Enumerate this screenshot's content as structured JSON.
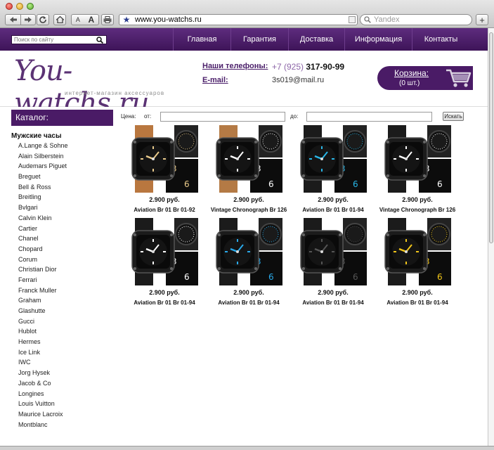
{
  "browser": {
    "url": "www.you-watchs.ru",
    "search_engine_placeholder": "Yandex",
    "text_small": "A",
    "text_big": "A",
    "add_tab": "+"
  },
  "site_search": {
    "placeholder": "Поиск по сайту"
  },
  "nav": {
    "items": [
      "Главная",
      "Гарантия",
      "Доставка",
      "Информация",
      "Контакты"
    ]
  },
  "header": {
    "logo_text": "You-watchs.ru",
    "tagline": "интернет-магазин аксессуаров",
    "phones_label": "Наши телефоны:",
    "phone_code": "+7 (925)",
    "phone_number": "317-90-99",
    "email_label": "E-mail:",
    "email_value": "3s019@mail.ru",
    "cart_title": "Корзина:",
    "cart_count": "(0 шт.)"
  },
  "sidebar": {
    "heading": "Каталог:",
    "category": "Мужские часы",
    "brands": [
      "A.Lange & Sohne",
      "Alain Silberstein",
      "Audemars Piguet",
      "Breguet",
      "Bell & Ross",
      "Breitling",
      "Bvlgari",
      "Calvin Klein",
      "Cartier",
      "Chanel",
      "Chopard",
      "Corum",
      "Christian Dior",
      "Ferrari",
      "Franck Muller",
      "Graham",
      "Glashutte",
      "Gucci",
      "Hublot",
      "Hermes",
      "Ice Link",
      "IWC",
      "Jorg Hysek",
      "Jacob & Co",
      "Longines",
      "Louis Vuitton",
      "Maurice Lacroix",
      "Montblanc"
    ]
  },
  "filter": {
    "price_label": "Цена:",
    "from_label": "от:",
    "to_label": "до:",
    "from_value": "",
    "to_value": "",
    "submit_label": "Искать"
  },
  "products": [
    {
      "price": "2.900 руб.",
      "name": "Aviation Br 01 Br 01-92",
      "accent": "#e8c98a",
      "strap": "#b9773f"
    },
    {
      "price": "2.900 руб.",
      "name": "Vintage Chronograph Br 126",
      "accent": "#ffffff",
      "strap": "#b47a45"
    },
    {
      "price": "2.900 руб.",
      "name": "Aviation Br 01 Br 01-94",
      "accent": "#28b6e6",
      "strap": "#1b1b1b"
    },
    {
      "price": "2.900 руб.",
      "name": "Vintage Chronograph Br 126",
      "accent": "#ffffff",
      "strap": "#1b1b1b"
    },
    {
      "price": "2.900 руб.",
      "name": "Aviation Br 01 Br 01-94",
      "accent": "#ffffff",
      "strap": "#1b1b1b"
    },
    {
      "price": "2.900 руб.",
      "name": "Aviation Br 01 Br 01-94",
      "accent": "#29a9ea",
      "strap": "#1b1b1b"
    },
    {
      "price": "2.900 руб.",
      "name": "Aviation Br 01 Br 01-94",
      "accent": "#555555",
      "strap": "#1b1b1b"
    },
    {
      "price": "2.900 руб.",
      "name": "Aviation Br 01 Br 01-94",
      "accent": "#f2c619",
      "strap": "#1b1b1b"
    }
  ],
  "colors": {
    "brand_purple": "#4a1b66",
    "nav_gradient_top": "#5e2c7e",
    "link_purple": "#4b1f6a"
  }
}
